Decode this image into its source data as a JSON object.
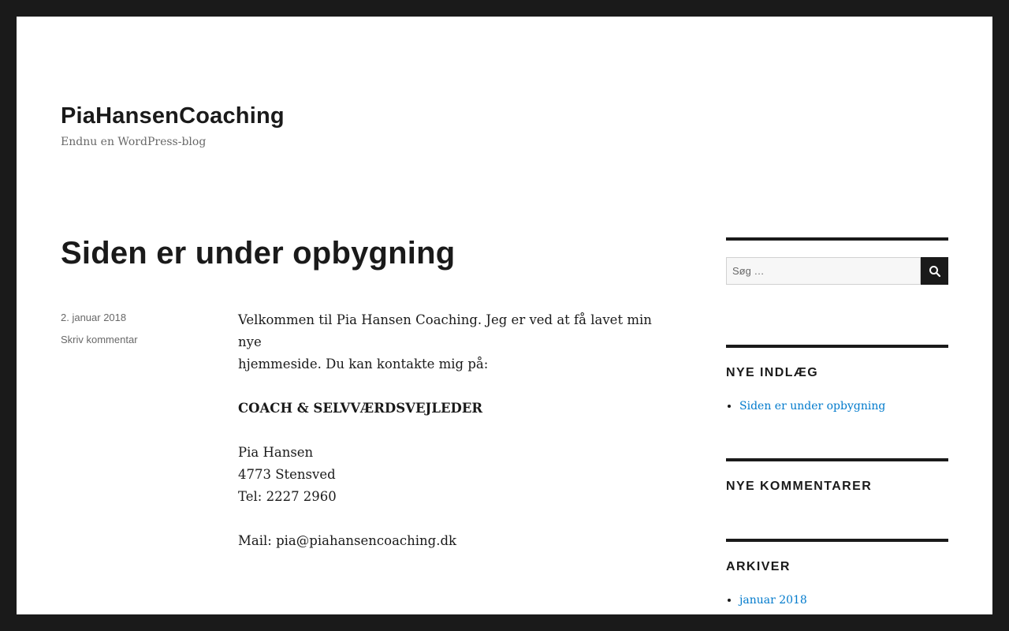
{
  "header": {
    "site_title": "PiaHansenCoaching",
    "site_description": "Endnu en WordPress-blog"
  },
  "post": {
    "title": "Siden er under opbygning",
    "date": "2. januar 2018",
    "comment_link": "Skriv kommentar",
    "content": {
      "intro_line1": "Velkommen til Pia Hansen Coaching. Jeg er ved at få lavet min nye",
      "intro_line2": "hjemmeside. Du kan kontakte mig på:",
      "title_line": "COACH &  SELVVÆRDSVEJLEDER",
      "name": "Pia Hansen",
      "address": "4773 Stensved",
      "phone": "Tel: 2227 2960",
      "mail": "Mail: pia@piahansencoaching.dk"
    }
  },
  "sidebar": {
    "search": {
      "placeholder": "Søg …",
      "value": "",
      "button_icon": "search-icon"
    },
    "recent_posts": {
      "title": "NYE INDLÆG",
      "items": [
        "Siden er under opbygning"
      ]
    },
    "recent_comments": {
      "title": "NYE KOMMENTARER"
    },
    "archives": {
      "title": "ARKIVER",
      "items": [
        "januar 2018"
      ]
    }
  },
  "colors": {
    "frame": "#1a1a1a",
    "text": "#1a1a1a",
    "muted": "#686868",
    "link": "#007acc",
    "background": "#ffffff"
  }
}
